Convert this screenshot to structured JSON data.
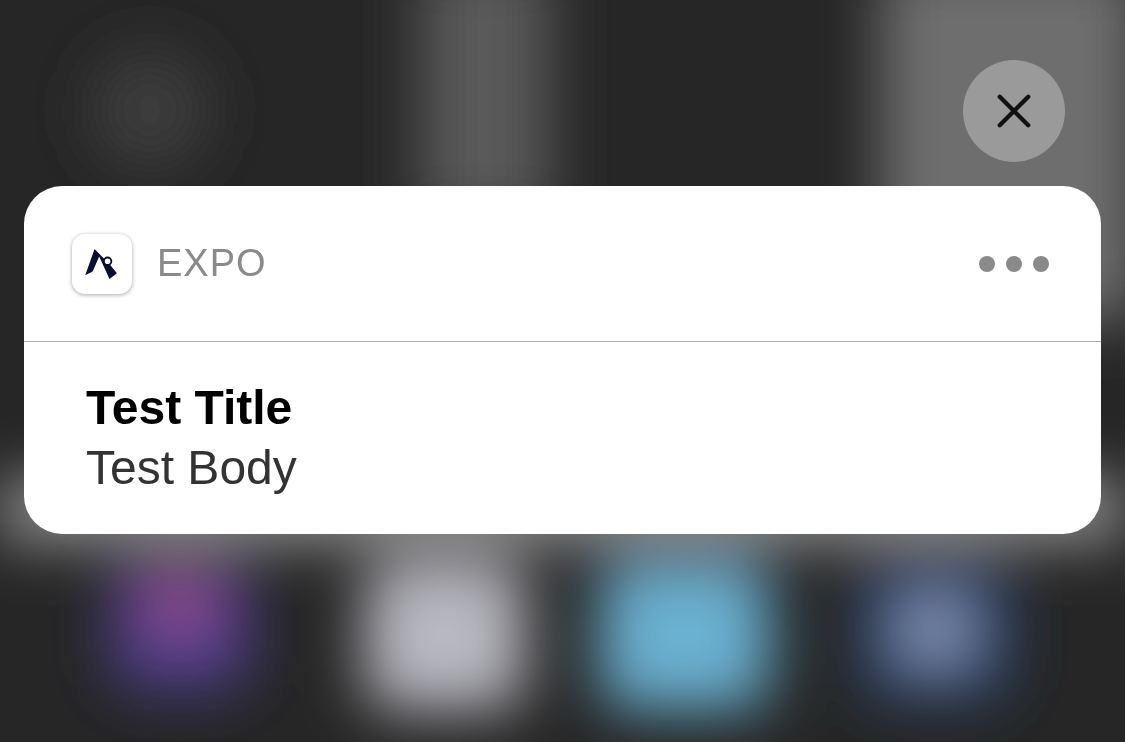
{
  "notification": {
    "app_name": "EXPO",
    "title": "Test Title",
    "body": "Test Body"
  }
}
